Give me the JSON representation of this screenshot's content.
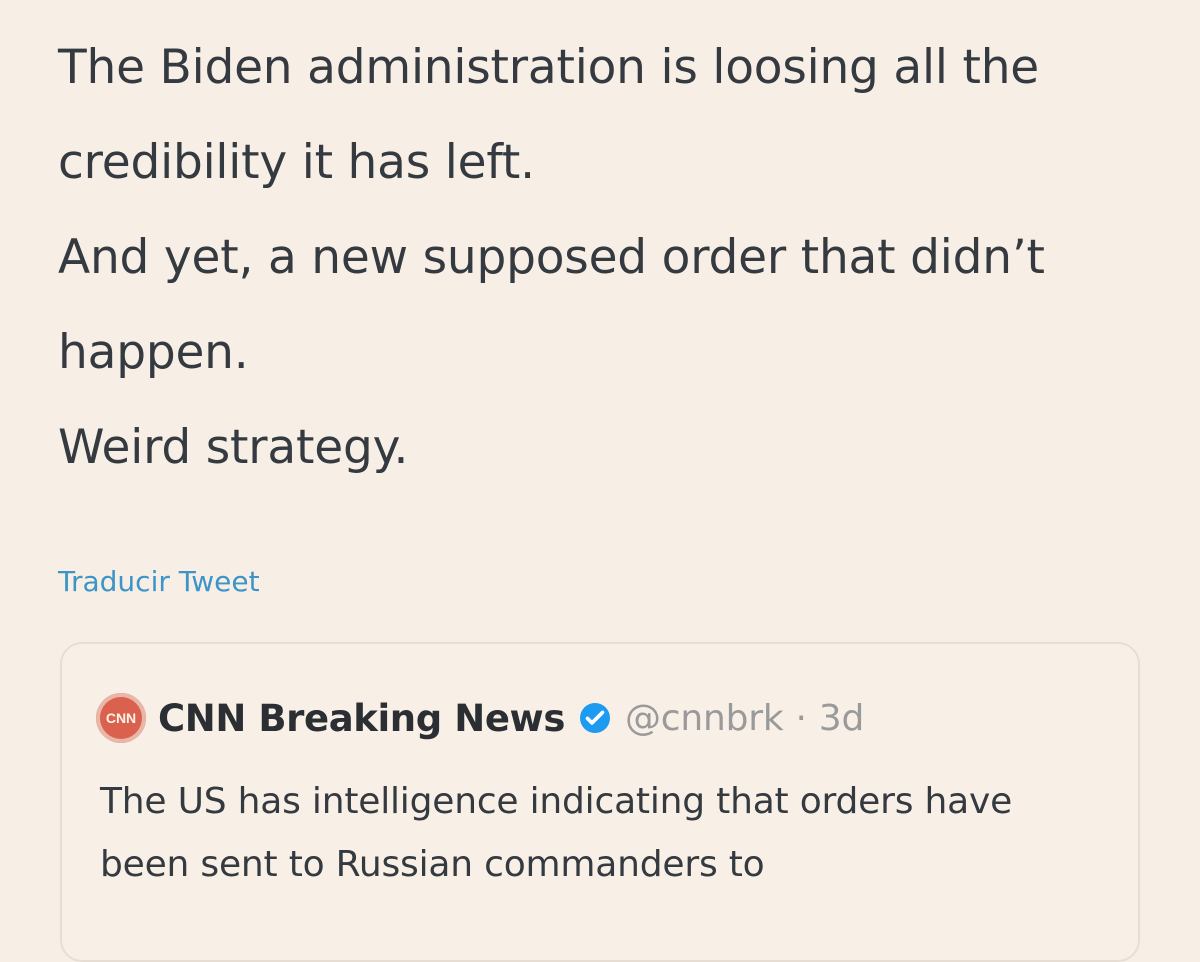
{
  "tweet": {
    "paragraphs": [
      "The Biden administration is loosing all the credibility it has left.",
      "And yet, a new supposed order that didn’t happen.",
      "Weird strategy."
    ],
    "translate_label": "Traducir Tweet"
  },
  "quote": {
    "author": "CNN Breaking News",
    "handle": "@cnnbrk",
    "separator": "·",
    "age": "3d",
    "text": "The US has intelligence indicating that orders have been sent to Russian commanders to"
  },
  "colors": {
    "background": "#f7efe6",
    "text": "#343a40",
    "link": "#3d95c7",
    "verified": "#1d9bf0",
    "cnn_red": "#d9614d"
  },
  "icons": {
    "verified": "verified-badge-icon",
    "avatar": "cnn-avatar-icon"
  }
}
